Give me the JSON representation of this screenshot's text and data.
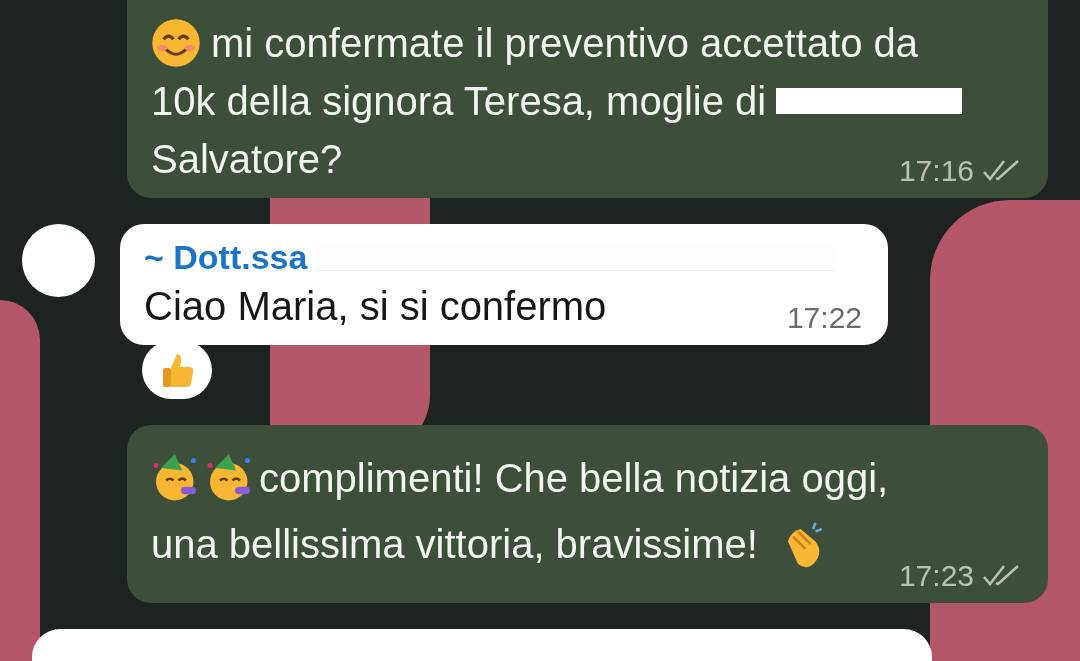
{
  "messages": [
    {
      "outgoing": true,
      "lines": [
        [
          {
            "kind": "smile-emoji"
          },
          {
            "kind": "text",
            "text": "mi confermate il preventivo accettato da"
          }
        ],
        [
          {
            "kind": "text",
            "text": "10k della signora Teresa, moglie di"
          },
          {
            "kind": "redacted"
          }
        ],
        [
          {
            "kind": "text",
            "text": "Salvatore?"
          }
        ]
      ],
      "time": "17:16",
      "read": false
    },
    {
      "outgoing": false,
      "sender": "~ Dott.ssa",
      "sender_redacted": true,
      "lines": [
        [
          {
            "kind": "text",
            "text": "Ciao Maria, si si confermo"
          }
        ]
      ],
      "time": "17:22",
      "reacted": true
    },
    {
      "outgoing": true,
      "lines": [
        [
          {
            "kind": "party-emoji"
          },
          {
            "kind": "party-emoji"
          },
          {
            "kind": "text",
            "text": "complimenti! Che bella notizia oggi,"
          }
        ],
        [
          {
            "kind": "text",
            "text": "una bellissima vittoria, bravissime!"
          },
          {
            "kind": "clap-emoji"
          }
        ]
      ],
      "time": "17:23",
      "read": false
    },
    {
      "outgoing": false
    }
  ]
}
